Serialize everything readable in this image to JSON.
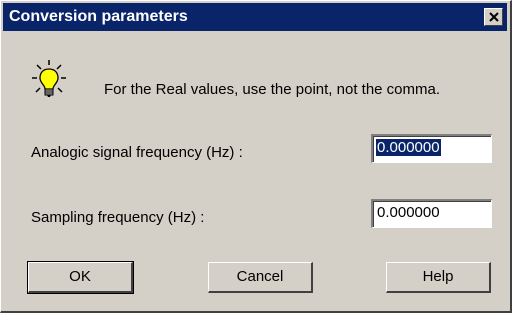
{
  "window": {
    "title": "Conversion parameters"
  },
  "hint": {
    "icon": "lightbulb-icon",
    "text": "For the Real values, use the point, not the comma."
  },
  "fields": {
    "analogic": {
      "label": "Analogic signal frequency (Hz) :",
      "value": "0.000000",
      "selected": true
    },
    "sampling": {
      "label": "Sampling frequency (Hz) :",
      "value": "0.000000"
    }
  },
  "buttons": {
    "ok": "OK",
    "cancel": "Cancel",
    "help": "Help"
  },
  "colors": {
    "titlebar": "#0a246a",
    "face": "#d4d0c8",
    "selection": "#0a246a"
  }
}
